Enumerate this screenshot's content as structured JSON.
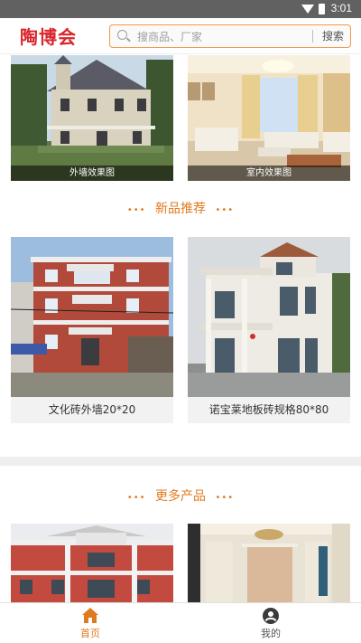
{
  "status_bar": {
    "time": "3:01"
  },
  "header": {
    "logo": "陶博会",
    "search_placeholder": "搜商品、厂家",
    "search_button": "搜索"
  },
  "top_cards": [
    {
      "caption": "外墙效果图"
    },
    {
      "caption": "室内效果图"
    }
  ],
  "new_products": {
    "title": "新品推荐",
    "items": [
      {
        "name": "文化砖外墙20*20"
      },
      {
        "name": "诺宝莱地板砖规格80*80"
      }
    ]
  },
  "more_products": {
    "title": "更多产品"
  },
  "tabbar": {
    "tabs": [
      {
        "label": "首页",
        "icon": "home-icon",
        "active": true
      },
      {
        "label": "我的",
        "icon": "user-icon",
        "active": false
      }
    ]
  },
  "colors": {
    "accent": "#e07a1f",
    "logo": "#d9262b",
    "search_border": "#f29a48"
  }
}
